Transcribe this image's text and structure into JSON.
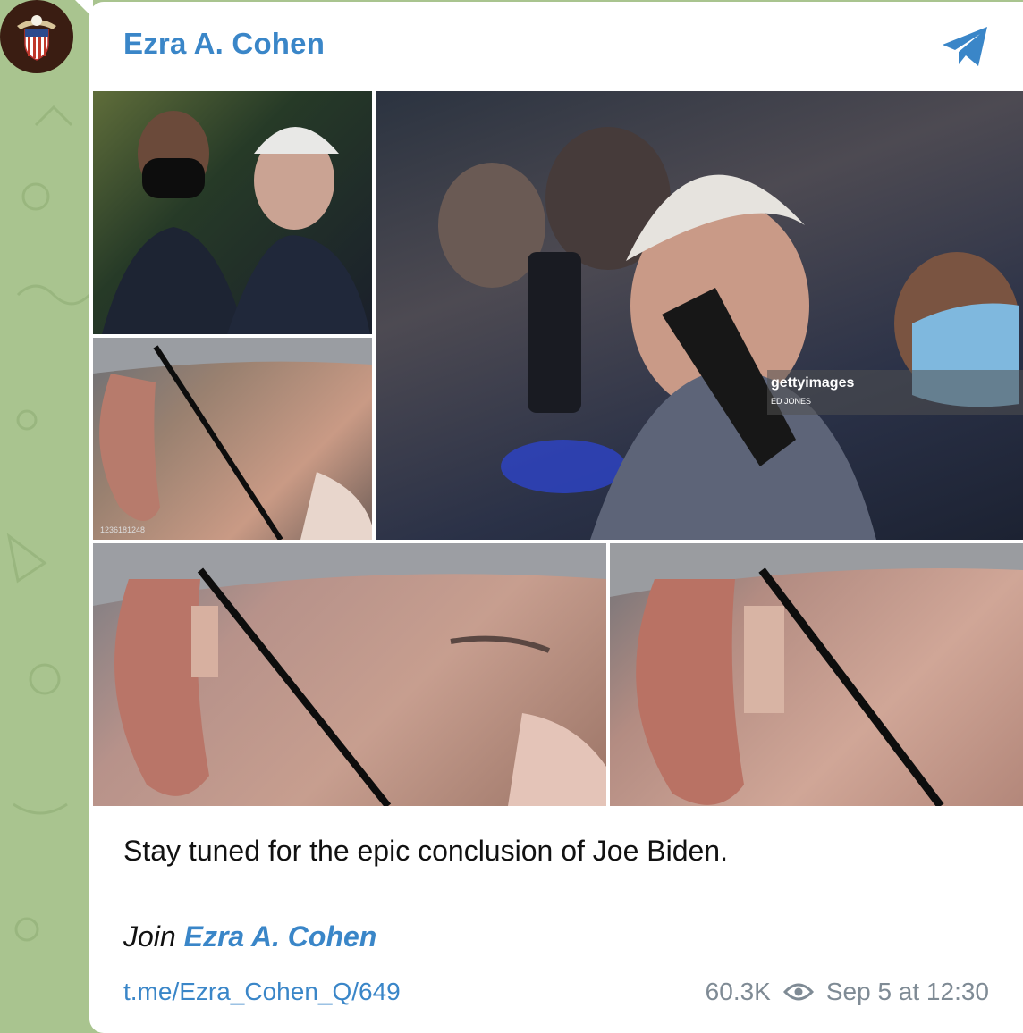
{
  "channel": {
    "name": "Ezra A. Cohen"
  },
  "photos": {
    "watermark_brand": "gettyimages",
    "watermark_credit": "ED JONES",
    "image_id": "1236181248"
  },
  "message": {
    "caption": "Stay tuned for the epic conclusion of Joe Biden.",
    "join_prefix": "Join ",
    "join_link": "Ezra A. Cohen",
    "post_link": "t.me/Ezra_Cohen_Q/649",
    "views": "60.3K",
    "timestamp": "Sep 5 at 12:30"
  },
  "icons": {
    "avatar": "eagle-shield-icon",
    "share": "telegram-icon",
    "views": "eye-icon"
  },
  "colors": {
    "accent": "#3a86c8",
    "wallpaper": "#a9c48f",
    "meta_text": "#7f8b95"
  }
}
